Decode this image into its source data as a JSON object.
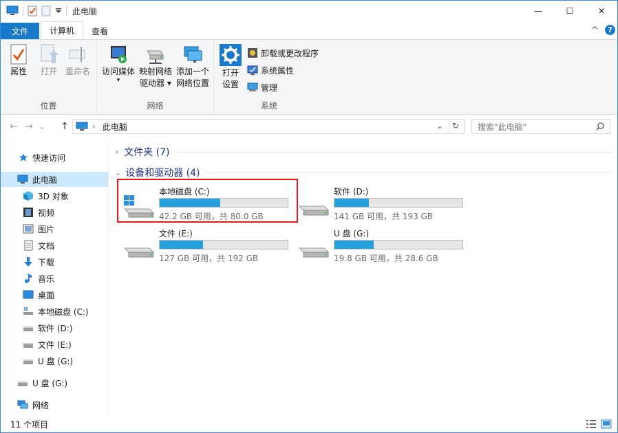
{
  "window": {
    "title": "此电脑",
    "minimize_glyph": "—",
    "maximize_glyph": "☐",
    "close_glyph": "✕",
    "help_glyph": "?",
    "collapse_glyph": "^"
  },
  "ribbon_tabs": {
    "file": "文件",
    "computer": "计算机",
    "view": "查看"
  },
  "ribbon": {
    "location": {
      "label": "位置",
      "properties": "属性",
      "open": "打开",
      "rename": "重命名"
    },
    "network": {
      "label": "网络",
      "access_media_line1": "访问媒体",
      "map_drive_line1": "映射网络",
      "map_drive_line2": "驱动器 ▾",
      "add_location_line1": "添加一个",
      "add_location_line2": "网络位置"
    },
    "system": {
      "label": "系统",
      "settings_line1": "打开",
      "settings_line2": "设置",
      "uninstall": "卸载或更改程序",
      "system_properties": "系统属性",
      "manage": "管理"
    }
  },
  "address": {
    "path": "此电脑",
    "search_placeholder": "搜索\"此电脑\"",
    "back": "←",
    "forward": "→",
    "up": "↑",
    "recent": "⌄",
    "dropdown": "⌄",
    "refresh": "↻"
  },
  "sidebar": {
    "items": [
      {
        "label": "快速访问",
        "icon": "star-icon"
      },
      {
        "label": "此电脑",
        "icon": "pc-icon"
      },
      {
        "label": "3D 对象",
        "icon": "cube-icon"
      },
      {
        "label": "视频",
        "icon": "video-icon"
      },
      {
        "label": "图片",
        "icon": "picture-icon"
      },
      {
        "label": "文档",
        "icon": "document-icon"
      },
      {
        "label": "下载",
        "icon": "download-icon"
      },
      {
        "label": "音乐",
        "icon": "music-icon"
      },
      {
        "label": "桌面",
        "icon": "desktop-icon"
      },
      {
        "label": "本地磁盘 (C:)",
        "icon": "drive-icon"
      },
      {
        "label": "软件 (D:)",
        "icon": "drive-icon"
      },
      {
        "label": "文件 (E:)",
        "icon": "drive-icon"
      },
      {
        "label": "U 盘 (G:)",
        "icon": "drive-icon"
      },
      {
        "label": "U 盘 (G:)",
        "icon": "usb-drive-icon"
      },
      {
        "label": "网络",
        "icon": "network-icon"
      }
    ]
  },
  "content": {
    "folders_header": "文件夹 (7)",
    "devices_header": "设备和驱动器 (4)",
    "drives": [
      {
        "name": "本地磁盘 (C:)",
        "info": "42.2 GB 可用，共 80.0 GB",
        "used_fraction": 0.4725
      },
      {
        "name": "软件 (D:)",
        "info": "141 GB 可用，共 193 GB",
        "used_fraction": 0.2694
      },
      {
        "name": "文件 (E:)",
        "info": "127 GB 可用，共 192 GB",
        "used_fraction": 0.3385
      },
      {
        "name": "U 盘 (G:)",
        "info": "19.8 GB 可用，共 28.6 GB",
        "used_fraction": 0.3077
      }
    ]
  },
  "statusbar": {
    "count": "11 个项目"
  },
  "colors": {
    "accent": "#1979ca",
    "bar_fill": "#26a0da",
    "highlight": "#e8191b"
  }
}
